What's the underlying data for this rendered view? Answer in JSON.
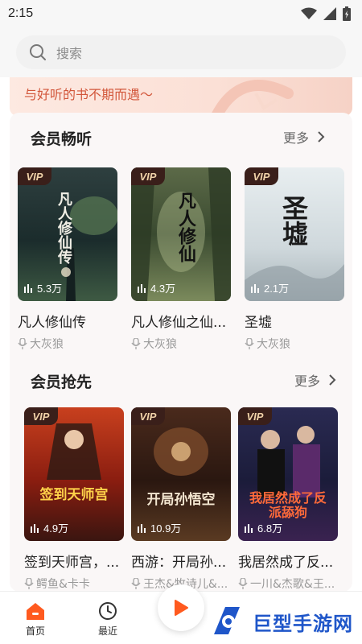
{
  "status_bar": {
    "time": "2:15"
  },
  "search": {
    "placeholder": "搜索"
  },
  "banner": {
    "text": "与好听的书不期而遇～"
  },
  "sections": [
    {
      "title": "会员畅听",
      "more": "更多",
      "books": [
        {
          "title": "凡人修仙传",
          "author": "大灰狼",
          "plays": "5.3万",
          "badge": "VIP",
          "cover_text": "凡人修仙传",
          "cover_color": "#1d3a3a"
        },
        {
          "title": "凡人修仙之仙...",
          "author": "大灰狼",
          "plays": "4.3万",
          "badge": "VIP",
          "cover_text": "凡人修仙",
          "cover_color": "#4a5a3a"
        },
        {
          "title": "圣墟",
          "author": "大灰狼",
          "plays": "2.1万",
          "badge": "VIP",
          "cover_text": "圣墟",
          "cover_color": "#d8e0e2"
        }
      ]
    },
    {
      "title": "会员抢先",
      "more": "更多",
      "books": [
        {
          "title": "签到天师宫，...",
          "author": "鳄鱼&卡卡",
          "plays": "4.9万",
          "badge": "VIP",
          "cover_text": "签到天师宫",
          "cover_color": "#b0301c"
        },
        {
          "title": "西游：开局孙...",
          "author": "王杰&牧诗儿&...",
          "plays": "10.9万",
          "badge": "VIP",
          "cover_text": "开局孙悟空",
          "cover_color": "#3a1e16"
        },
        {
          "title": "我居然成了反...",
          "author": "一川&杰歌&王...",
          "plays": "6.8万",
          "badge": "VIP",
          "cover_text": "我居然成了反派舔狗",
          "cover_color": "#1e2142"
        }
      ]
    }
  ],
  "nav": {
    "home": "首页",
    "recent": "最近"
  },
  "watermark": {
    "text": "巨型手游网"
  },
  "colors": {
    "accent": "#ff5a1f",
    "vip_bg": "#3a1f1a",
    "vip_text": "#f0d2a8"
  }
}
